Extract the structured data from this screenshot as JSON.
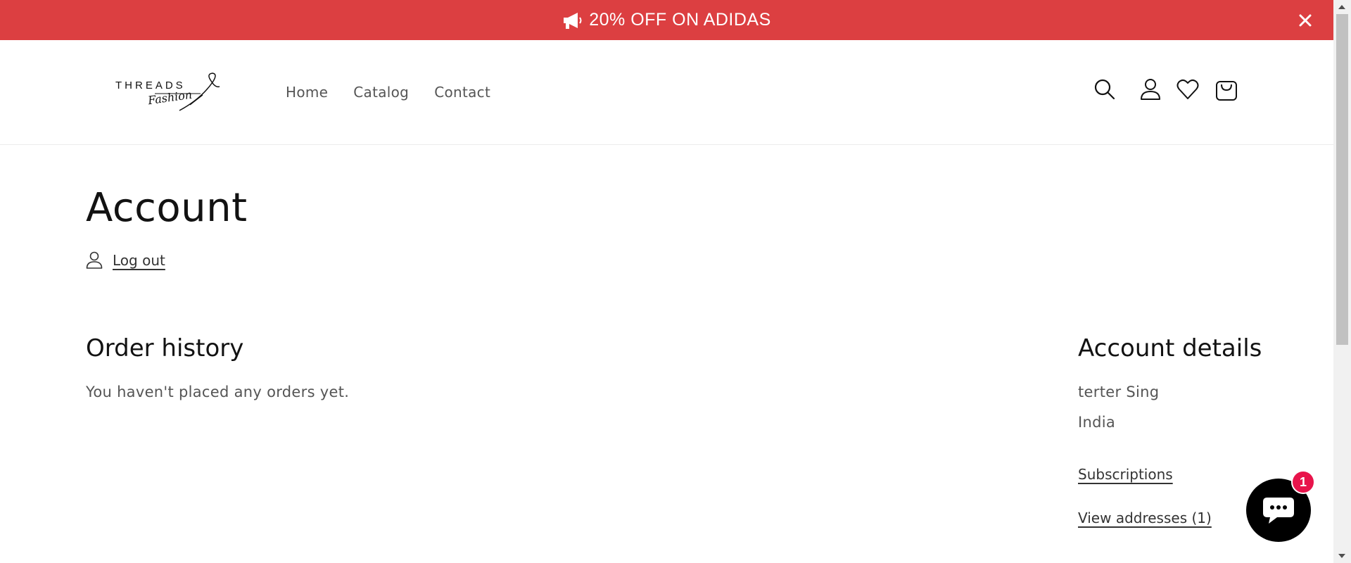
{
  "announcement": {
    "text": "20% OFF ON ADIDAS",
    "close_icon": "close-icon",
    "megaphone_icon": "megaphone-icon"
  },
  "logo": {
    "brand": "THREADS",
    "sub": "Fashion"
  },
  "nav": {
    "home": "Home",
    "catalog": "Catalog",
    "contact": "Contact"
  },
  "header_icons": [
    "search-icon",
    "account-icon",
    "heart-icon",
    "cart-icon"
  ],
  "page": {
    "title": "Account",
    "logout": "Log out"
  },
  "orders": {
    "title": "Order history",
    "empty": "You haven't placed any orders yet."
  },
  "account": {
    "title": "Account details",
    "name": "terter Sing",
    "country": "India",
    "subscriptions": "Subscriptions",
    "addresses": "View addresses (1)"
  },
  "chat": {
    "badge": "1"
  },
  "colors": {
    "announcement_bg": "#dc3f41",
    "chat_badge": "#e8144b",
    "chat_bg": "#000000"
  }
}
